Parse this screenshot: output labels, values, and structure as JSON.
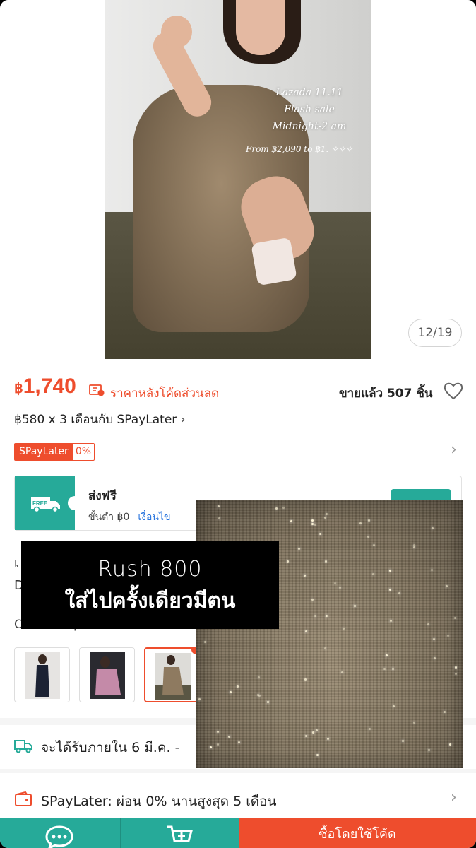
{
  "image_counter": "12/19",
  "promo_overlay": {
    "line1": "Lazada 11.11",
    "line2": "Flash sale",
    "line3": "Midnight-2 am",
    "from": "From ฿2,090 to ฿1. ✧✧✧"
  },
  "price": {
    "currency": "฿",
    "amount": "1,740",
    "coupon_label": "ราคาหลังโค้ดส่วนลด"
  },
  "sold": "ขายแล้ว 507 ชิ้น",
  "installment": "฿580 x 3 เดือนกับ SPayLater",
  "spaylater_tag": {
    "name": "SPayLater",
    "rate": "0%"
  },
  "shipping": {
    "badge": "FREE",
    "title": "ส่งฟรี",
    "min": "ขั้นต่ำ ฿0",
    "condition_link": "เงื่อนไข"
  },
  "partial_text": {
    "a": "เ",
    "b": "D"
  },
  "color_label": "Color: Taupe Brown",
  "variants": [
    {
      "name": "black"
    },
    {
      "name": "pink"
    },
    {
      "name": "taupe",
      "selected": true
    }
  ],
  "delivery": "จะได้รับภายใน 6 มี.ค. -",
  "spaylater_info": "SPayLater: ผ่อน 0% นานสูงสุด   5 เดือน",
  "bottom_bar": {
    "buy_label": "ซื้อโดยใช้โค้ด"
  },
  "sticker": {
    "line1": "Rush 800",
    "line2": "ใส่ไปครั้งเดียวมีตน"
  },
  "colors": {
    "accent": "#ee4d2d",
    "teal": "#26aa99",
    "link": "#2673dd"
  }
}
